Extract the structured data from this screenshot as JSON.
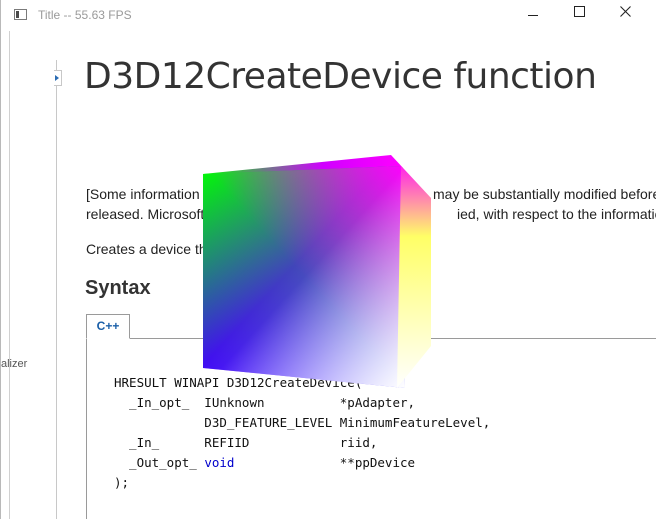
{
  "window": {
    "title": "Title -- 55.63 FPS"
  },
  "sidebar": {
    "partial_label": "alizer"
  },
  "page": {
    "title": "D3D12CreateDevice function",
    "para1_line1_left": "[Some information",
    "para1_line1_right": "may be substantially modified before",
    "para1_line2_left": "released. Microsoft",
    "para1_line2_right": "ied, with respect to the information p",
    "para2": "Creates a device th",
    "syntax_heading": "Syntax",
    "tab_label": "C++"
  },
  "code": {
    "line1": "HRESULT WINAPI D3D12CreateDevice(",
    "line2_prefix": "  _In_opt_  IUnknown          *pAdapter,",
    "line3": "            D3D_FEATURE_LEVEL MinimumFeatureLevel,",
    "line4": "  _In_      REFIID            riid,",
    "line5_prefix": "  _Out_opt_ ",
    "line5_keyword": "void",
    "line5_suffix": "              **ppDevice",
    "line6": ");"
  },
  "cube": {
    "front_colors": [
      "#00ff00",
      "#ff0000",
      "#0000ff",
      "#ffffff"
    ],
    "top_colors": [
      "#00ff00",
      "#ffff00",
      "#ff00ff",
      "#ff0000"
    ],
    "right_colors": [
      "#ff00ff",
      "#ffff00",
      "#ffffff"
    ]
  }
}
